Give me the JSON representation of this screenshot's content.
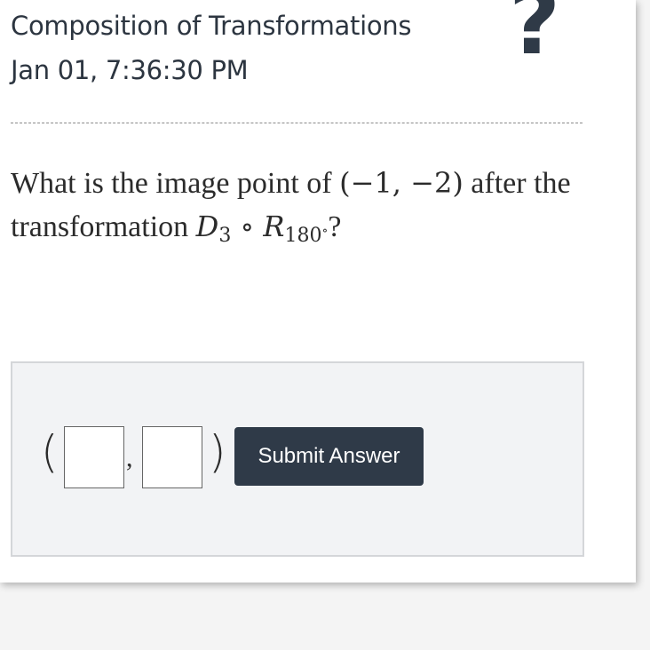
{
  "header": {
    "title": "Composition of Transformations",
    "timestamp": "Jan 01, 7:36:30 PM",
    "help_icon": "question-mark-icon"
  },
  "question": {
    "text_part1": "What is the image point of ",
    "point": "(−1, −2)",
    "text_part2": " after the transformation ",
    "dilation_letter": "D",
    "dilation_factor": "3",
    "compose_symbol": "∘",
    "rotation_letter": "R",
    "rotation_angle": "180",
    "degree_symbol": "∘",
    "text_end": "?"
  },
  "answer": {
    "open_paren": "(",
    "comma": ",",
    "close_paren": ")",
    "x_value": "",
    "y_value": "",
    "submit_label": "Submit Answer"
  }
}
